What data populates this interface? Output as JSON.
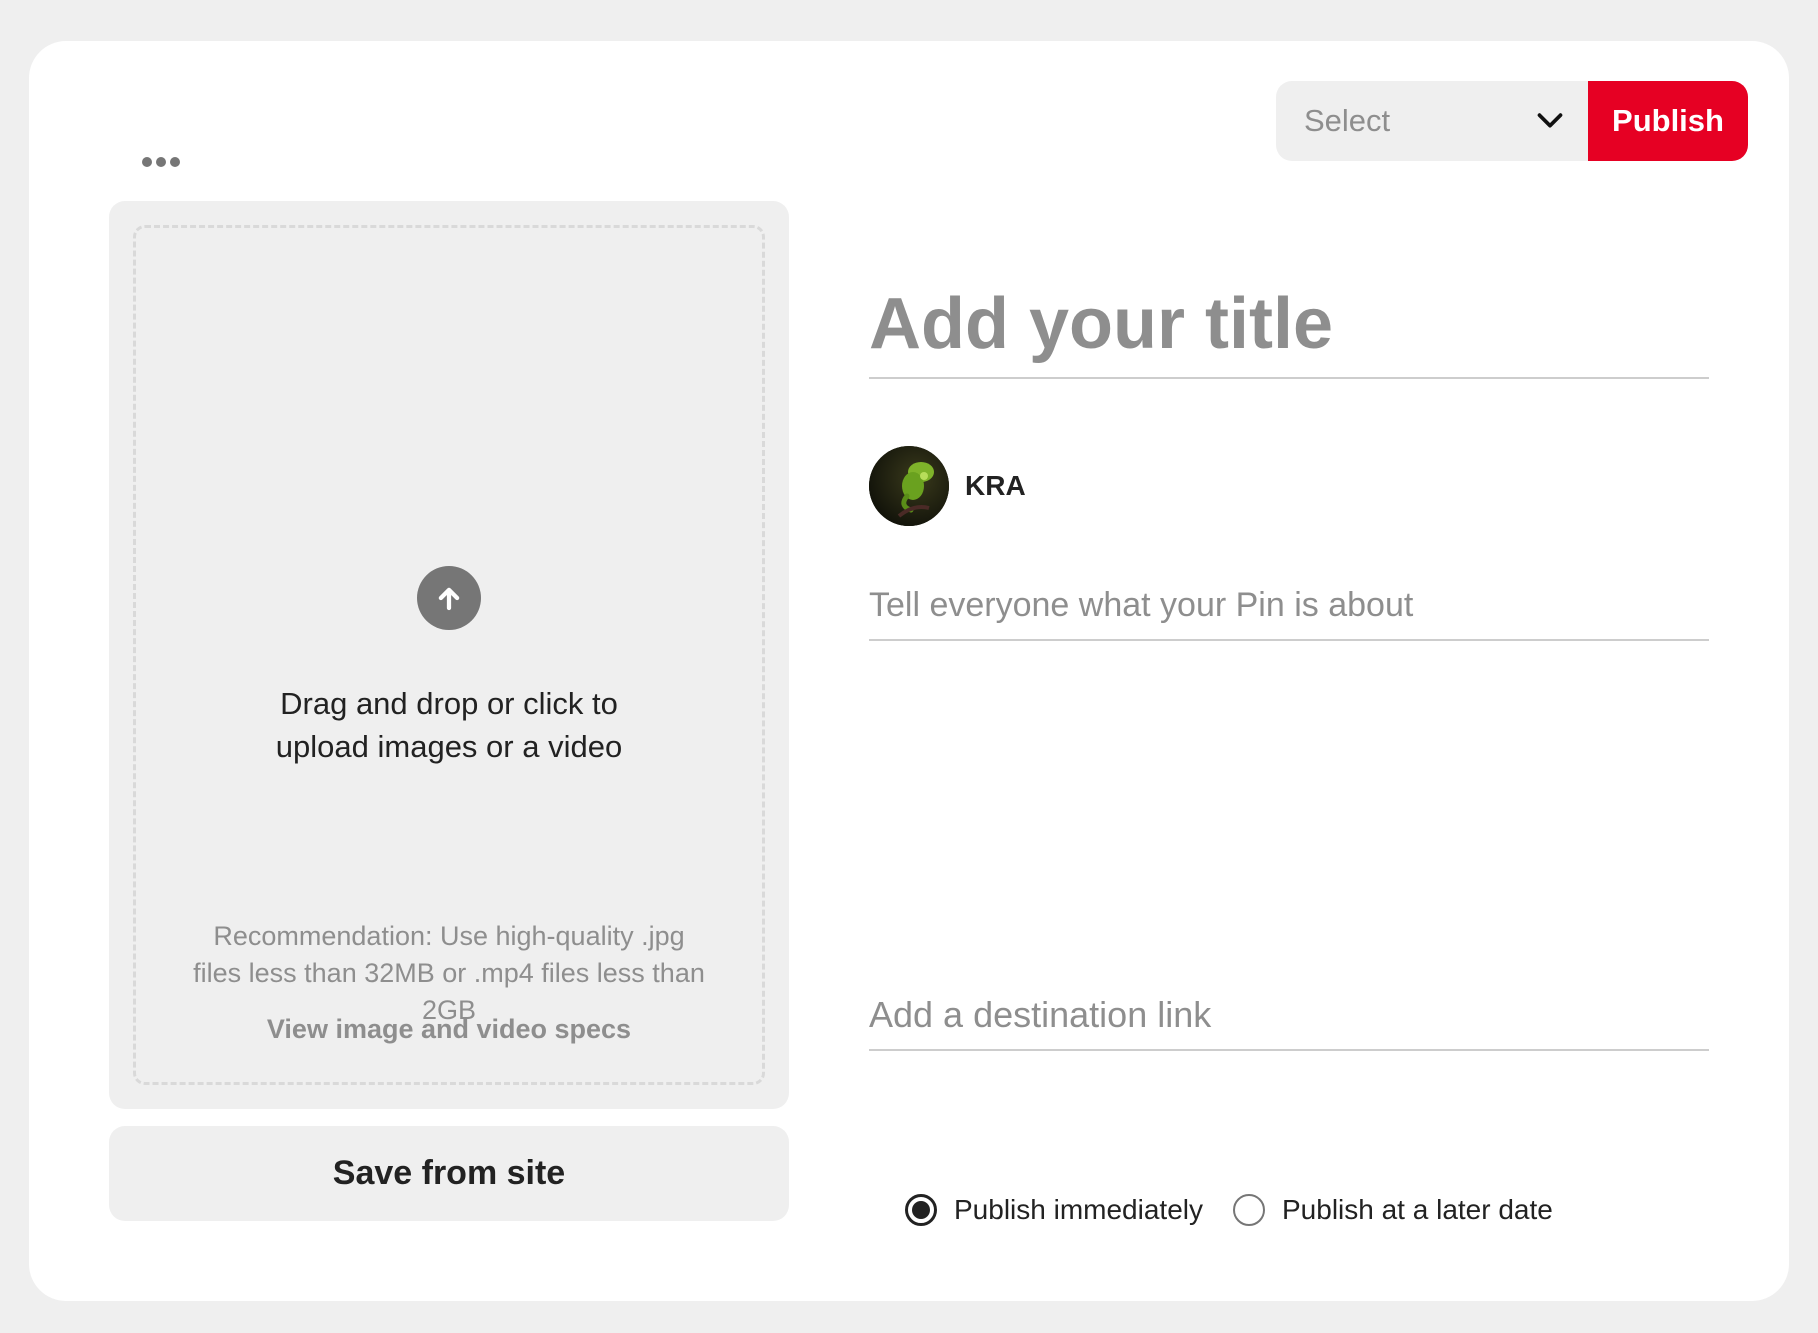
{
  "header": {
    "more_options_icon": "more-horizontal-icon",
    "board_select": {
      "value": "Select",
      "icon": "chevron-down-icon"
    },
    "publish_label": "Publish",
    "publish_color": "#e60023"
  },
  "upload": {
    "icon": "arrow-up-circle-icon",
    "drop_text": "Drag and drop or click to upload images or a video",
    "recommendation": "Recommendation: Use high-quality .jpg files less than 32MB or .mp4 files less than 2GB",
    "specs_link": "View image and video specs",
    "save_from_site": "Save from site"
  },
  "form": {
    "title_placeholder": "Add your title",
    "user": {
      "name": "KRA",
      "avatar_icon": "avatar-image"
    },
    "description_placeholder": "Tell everyone what your Pin is about",
    "link_placeholder": "Add a destination link"
  },
  "publish_options": {
    "immediately_label": "Publish immediately",
    "later_label": "Publish at a later date",
    "selected": "immediately"
  }
}
